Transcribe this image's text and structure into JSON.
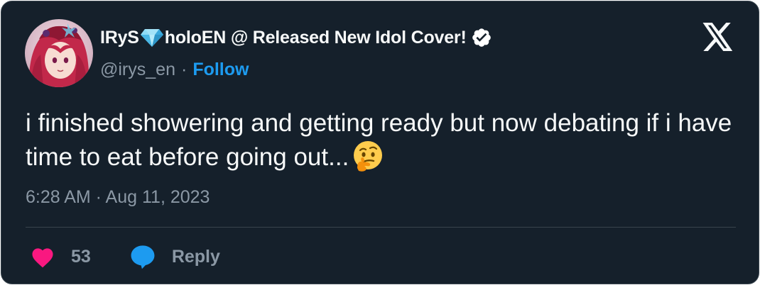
{
  "author": {
    "name_part1": "IRyS",
    "name_part2": "holoEN @ Released New Idol Cover!",
    "handle": "@irys_en",
    "separator": "·",
    "follow_label": "Follow",
    "verified": true
  },
  "tweet": {
    "text": "i finished showering and getting ready but now debating if i have time to eat before going out...",
    "emoji": "thinking-face",
    "timestamp": "6:28 AM · Aug 11, 2023"
  },
  "actions": {
    "like_count": "53",
    "reply_label": "Reply"
  },
  "colors": {
    "background": "#15202b",
    "border": "#38444d",
    "text": "#f7f9f9",
    "muted": "#8b98a5",
    "accent": "#1d9bf0",
    "like": "#f91880"
  }
}
